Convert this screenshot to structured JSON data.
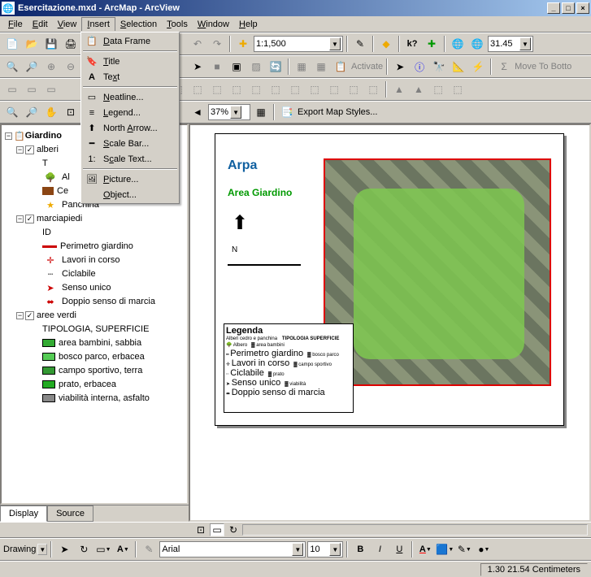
{
  "titlebar": {
    "icon": "🌐",
    "text": "Esercitazione.mxd - ArcMap - ArcView"
  },
  "menubar": {
    "items": [
      {
        "label": "File",
        "u": "F"
      },
      {
        "label": "Edit",
        "u": "E"
      },
      {
        "label": "View",
        "u": "V"
      },
      {
        "label": "Insert",
        "u": "I",
        "open": true
      },
      {
        "label": "Selection",
        "u": "S"
      },
      {
        "label": "Tools",
        "u": "T"
      },
      {
        "label": "Window",
        "u": "W"
      },
      {
        "label": "Help",
        "u": "H"
      }
    ]
  },
  "insert_menu": {
    "items": [
      {
        "icon": "📋",
        "label": "Data Frame",
        "u": "D"
      },
      {
        "icon": "T",
        "label": "Title",
        "u": "T"
      },
      {
        "icon": "A",
        "label": "Text",
        "u": "x"
      },
      {
        "icon": "▭",
        "label": "Neatline...",
        "u": "N"
      },
      {
        "icon": "≡",
        "label": "Legend...",
        "u": "L"
      },
      {
        "icon": "↑",
        "label": "North Arrow...",
        "u": "A"
      },
      {
        "icon": "━",
        "label": "Scale Bar...",
        "u": "S"
      },
      {
        "icon": "1:",
        "label": "Scale Text...",
        "u": "c"
      },
      {
        "icon": "🖼",
        "label": "Picture...",
        "u": "P"
      },
      {
        "icon": "",
        "label": "Object...",
        "u": "O"
      }
    ]
  },
  "toolbars": {
    "scale_combo": "1:1,500",
    "rotation": "31.45",
    "zoom_pct": "37%",
    "activate_label": "Activate",
    "moveto_label": "Move To Botto",
    "export_label": "Export Map Styles..."
  },
  "toc": {
    "root": "Giardino",
    "layers": [
      {
        "indent": 1,
        "chk": true,
        "label": "alberi"
      },
      {
        "indent": 2,
        "label": "T"
      },
      {
        "indent": 2,
        "sym": "tree",
        "label": "Al"
      },
      {
        "indent": 2,
        "sym": "brown",
        "label": "Ce"
      },
      {
        "indent": 2,
        "sym": "yellow",
        "label": "Panchina"
      },
      {
        "indent": 1,
        "chk": true,
        "label": "marciapiedi"
      },
      {
        "indent": 2,
        "label": "ID"
      },
      {
        "indent": 2,
        "sym": "redline",
        "label": "Perimetro giardino"
      },
      {
        "indent": 2,
        "sym": "redcross",
        "label": "Lavori in corso"
      },
      {
        "indent": 2,
        "sym": "dashline",
        "label": "Ciclabile"
      },
      {
        "indent": 2,
        "sym": "arrow",
        "label": "Senso unico"
      },
      {
        "indent": 2,
        "sym": "darrow",
        "label": "Doppio senso di marcia"
      },
      {
        "indent": 1,
        "chk": true,
        "label": "aree verdi"
      },
      {
        "indent": 2,
        "label": "TIPOLOGIA, SUPERFICIE"
      },
      {
        "indent": 2,
        "sym": "g1",
        "label": "area bambini, sabbia"
      },
      {
        "indent": 2,
        "sym": "g2",
        "label": "bosco parco, erbacea"
      },
      {
        "indent": 2,
        "sym": "g3",
        "label": "campo sportivo, terra"
      },
      {
        "indent": 2,
        "sym": "g4",
        "label": "prato, erbacea"
      },
      {
        "indent": 2,
        "sym": "g5",
        "label": "viabilità interna, asfalto"
      }
    ],
    "tabs": {
      "display": "Display",
      "source": "Source"
    }
  },
  "map": {
    "logo_text": "Arpa",
    "area_label": "Area Giardino",
    "legend_title": "Legenda",
    "legend_col1": "Alberi cedro e panchina",
    "legend_col2": "TIPOLOGIA SUPERFICIE",
    "legend_items": [
      "Perimetro giardino",
      "Lavori in corso",
      "Ciclabile",
      "Senso unico",
      "Doppio senso di marcia"
    ]
  },
  "drawing_bar": {
    "label": "Drawing",
    "font": "Arial",
    "size": "10"
  },
  "statusbar": {
    "coords": "1.30  21.54 Centimeters"
  }
}
